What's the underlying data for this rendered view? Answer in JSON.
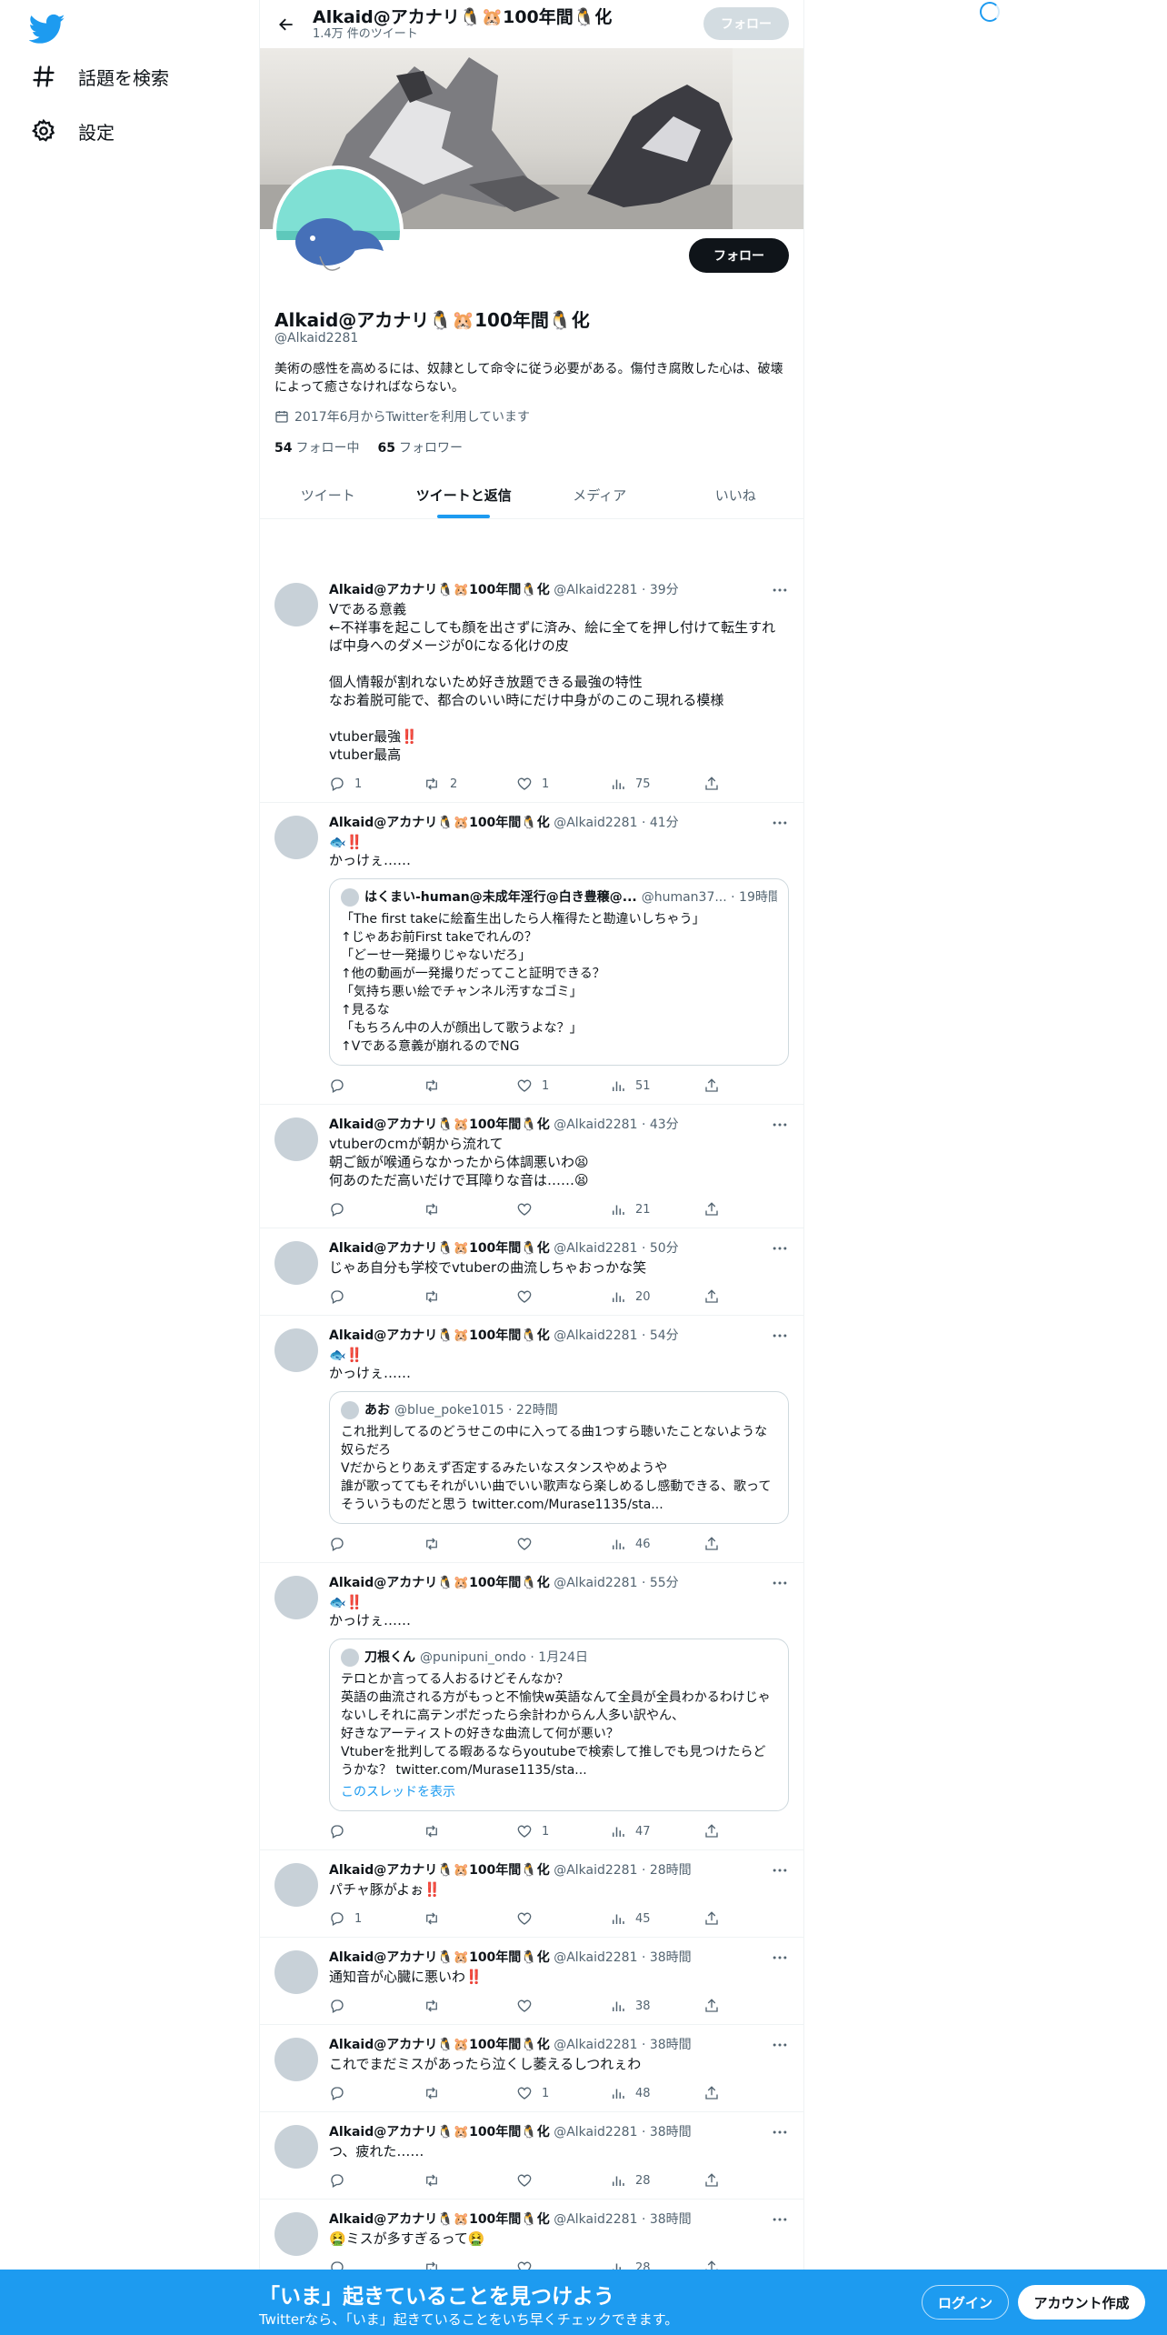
{
  "nav": {
    "items": [
      {
        "label": "話題を検索",
        "icon": "hashtag-icon"
      },
      {
        "label": "設定",
        "icon": "gear-icon"
      }
    ]
  },
  "topbar": {
    "name": "Alkaid@アカナリ🐧🐹100年間🐧化",
    "tweet_count": "1.4万 件のツイート",
    "follow_label": "フォロー"
  },
  "profile": {
    "follow_label": "フォロー",
    "name": "Alkaid@アカナリ🐧🐹100年間🐧化",
    "handle": "@Alkaid2281",
    "bio": "美術の感性を高めるには、奴隷として命令に従う必要がある。傷付き腐敗した心は、破壊によって癒さなければならない。",
    "joined": "2017年6月からTwitterを利用しています",
    "following_count": "54",
    "following_label": "フォロー中",
    "followers_count": "65",
    "followers_label": "フォロワー"
  },
  "tabs": [
    {
      "label": "ツイート",
      "active": false
    },
    {
      "label": "ツイートと返信",
      "active": true
    },
    {
      "label": "メディア",
      "active": false
    },
    {
      "label": "いいね",
      "active": false
    }
  ],
  "tweets": [
    {
      "name": "Alkaid@アカナリ🐧🐹100年間🐧化",
      "meta": "@Alkaid2281 · 39分",
      "body": "Vである意義\n←不祥事を起こしても顔を出さずに済み、絵に全てを押し付けて転生すれば中身へのダメージが0になる化けの皮\n\n個人情報が割れないため好き放題できる最強の特性\nなお着脱可能で、都合のいい時にだけ中身がのこのこ現れる模様\n\nvtuber最強",
      "body2": "\nvtuber最高",
      "emph": "‼️",
      "reply": "1",
      "retweet": "2",
      "like": "1",
      "views": "75"
    },
    {
      "name": "Alkaid@アカナリ🐧🐹100年間🐧化",
      "meta": "@Alkaid2281 · 41分",
      "body": "🐟",
      "emph": "‼️",
      "body2": "\nかっけぇ……",
      "reply": "",
      "retweet": "",
      "like": "1",
      "views": "51",
      "quote": {
        "name": "はくまい-human@未成年淫行@白き豊穣@...",
        "meta": "@human37... · 19時間",
        "body": "「The first takeに絵畜生出したら人権得たと勘違いしちゃう」\n↑じゃあお前First takeでれんの？\n「どーせ一発撮りじゃないだろ」\n↑他の動画が一発撮りだってこと証明できる？\n「気持ち悪い絵でチャンネル汚すなゴミ」\n↑見るな\n「もちろん中の人が顔出して歌うよな？」\n↑Vである意義が崩れるのでNG"
      }
    },
    {
      "name": "Alkaid@アカナリ🐧🐹100年間🐧化",
      "meta": "@Alkaid2281 · 43分",
      "body": "vtuberのcmが朝から流れて\n朝ご飯が喉通らなかったから体調悪いわ😫\n何あのただ高いだけで耳障りな音は……😫",
      "reply": "",
      "retweet": "",
      "like": "",
      "views": "21"
    },
    {
      "name": "Alkaid@アカナリ🐧🐹100年間🐧化",
      "meta": "@Alkaid2281 · 50分",
      "body": "じゃあ自分も学校でvtuberの曲流しちゃおっかな笑",
      "reply": "",
      "retweet": "",
      "like": "",
      "views": "20"
    },
    {
      "name": "Alkaid@アカナリ🐧🐹100年間🐧化",
      "meta": "@Alkaid2281 · 54分",
      "body": "🐟",
      "emph": "‼️",
      "body2": "\nかっけぇ……",
      "reply": "",
      "retweet": "",
      "like": "",
      "views": "46",
      "quote": {
        "name": "あお",
        "meta": "@blue_poke1015 · 22時間",
        "body": "これ批判してるのどうせこの中に入ってる曲1つすら聴いたことないような奴らだろ\nVだからとりあえず否定するみたいなスタンスやめようや\n誰が歌っててもそれがいい曲でいい歌声なら楽しめるし感動できる、歌ってそういうものだと思う twitter.com/Murase1135/sta..."
      }
    },
    {
      "name": "Alkaid@アカナリ🐧🐹100年間🐧化",
      "meta": "@Alkaid2281 · 55分",
      "body": "🐟",
      "emph": "‼️",
      "body2": "\nかっけぇ……",
      "reply": "",
      "retweet": "",
      "like": "1",
      "views": "47",
      "quote": {
        "name": "刀根くん",
        "meta": "@punipuni_ondo · 1月24日",
        "body": "テロとか言ってる人おるけどそんなか？\n英語の曲流される方がもっと不愉快w英語なんて全員が全員わかるわけじゃないしそれに高テンポだったら余計わからん人多い訳やん、\n好きなアーティストの好きな曲流して何が悪い？\nVtuberを批判してる暇あるならyoutubeで検索して推しでも見つけたらどうかな？ twitter.com/Murase1135/sta...",
        "link": "このスレッドを表示"
      }
    },
    {
      "name": "Alkaid@アカナリ🐧🐹100年間🐧化",
      "meta": "@Alkaid2281 · 28時間",
      "body": "パチャ豚がよぉ",
      "emph": "‼️",
      "reply": "1",
      "retweet": "",
      "like": "",
      "views": "45"
    },
    {
      "name": "Alkaid@アカナリ🐧🐹100年間🐧化",
      "meta": "@Alkaid2281 · 38時間",
      "body": "通知音が心臓に悪いわ",
      "emph": "‼️",
      "reply": "",
      "retweet": "",
      "like": "",
      "views": "38"
    },
    {
      "name": "Alkaid@アカナリ🐧🐹100年間🐧化",
      "meta": "@Alkaid2281 · 38時間",
      "body": "これでまだミスがあったら泣くし萎えるしつれぇわ",
      "reply": "",
      "retweet": "",
      "like": "1",
      "views": "48"
    },
    {
      "name": "Alkaid@アカナリ🐧🐹100年間🐧化",
      "meta": "@Alkaid2281 · 38時間",
      "body": "つ、疲れた……",
      "reply": "",
      "retweet": "",
      "like": "",
      "views": "28"
    },
    {
      "name": "Alkaid@アカナリ🐧🐹100年間🐧化",
      "meta": "@Alkaid2281 · 38時間",
      "body": "🤮ミスが多すぎるって🤮",
      "reply": "",
      "retweet": "",
      "like": "",
      "views": "28"
    }
  ],
  "bottom_bar": {
    "title": "「いま」起きていることを見つけよう",
    "subtitle": "Twitterなら、「いま」起きていることをいち早くチェックできます。",
    "login_label": "ログイン",
    "signup_label": "アカウント作成"
  },
  "colors": {
    "accent": "#1d9bf0",
    "text": "#0f1419",
    "muted": "#536471",
    "emphasis": "#d4232a"
  }
}
